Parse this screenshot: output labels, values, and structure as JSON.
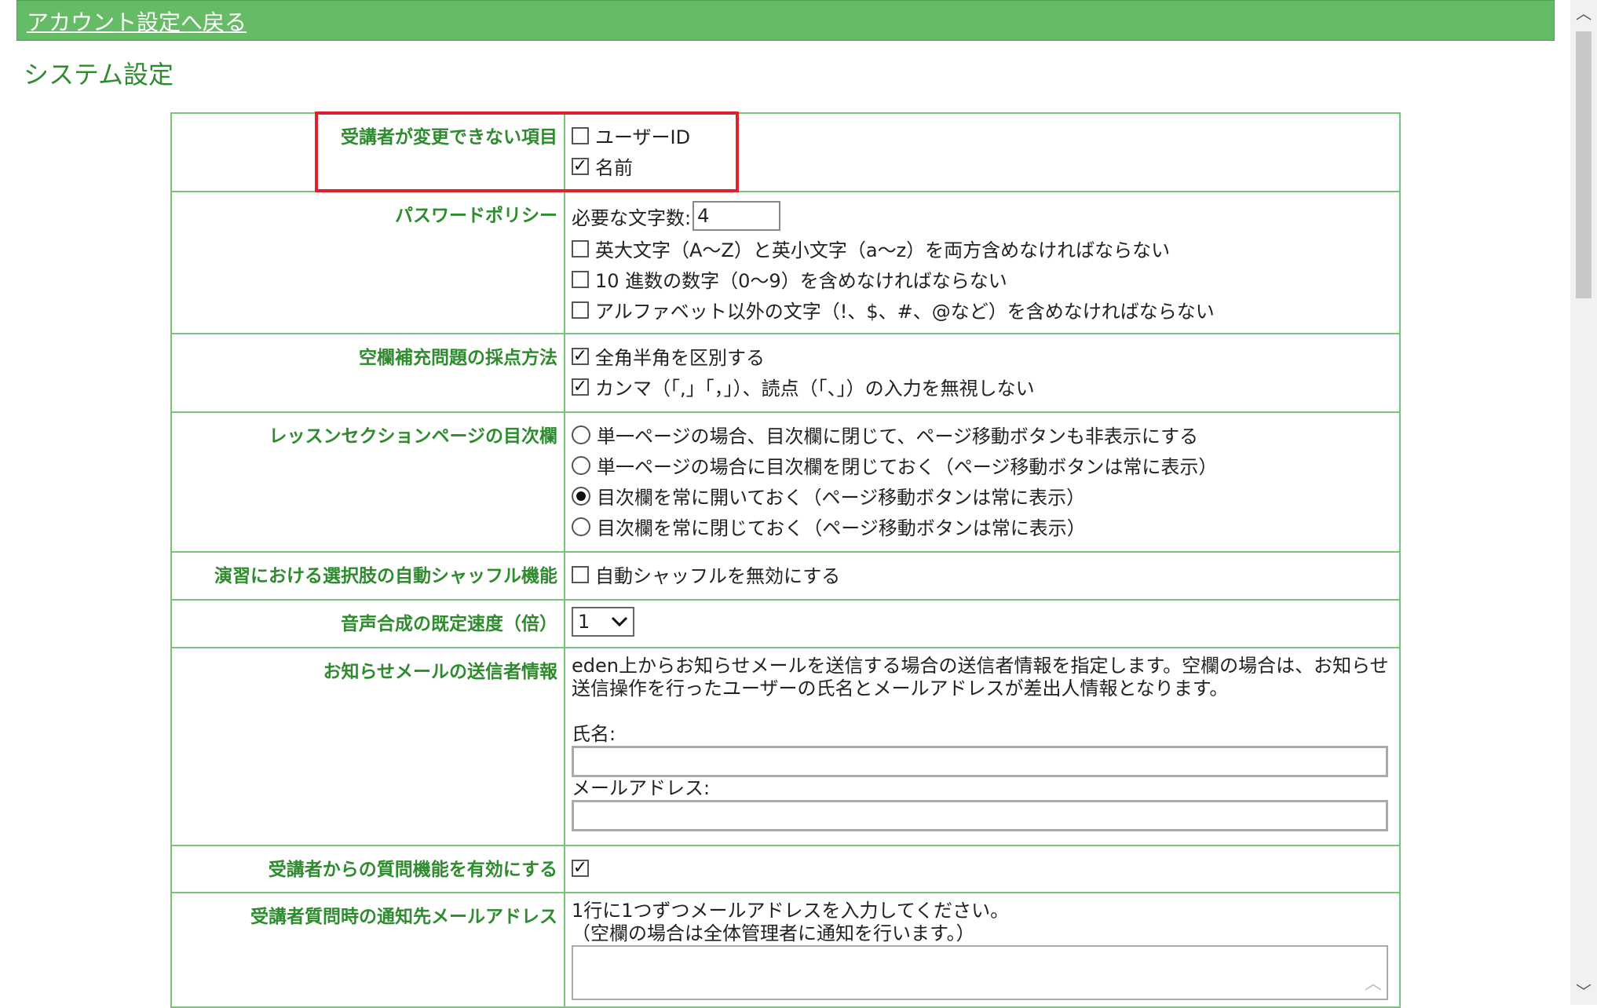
{
  "topbar": {
    "back_link": "アカウント設定へ戻る"
  },
  "page_title": "システム設定",
  "colors": {
    "bar": "#66bb66",
    "label_text": "#2e8b2e",
    "border": "#78c478",
    "highlight": "#e0202a"
  },
  "rows": {
    "readonly_items": {
      "label": "受講者が変更できない項目",
      "options": [
        {
          "label": "ユーザーID",
          "checked": false
        },
        {
          "label": "名前",
          "checked": true
        }
      ]
    },
    "password_policy": {
      "label": "パスワードポリシー",
      "min_chars_label": "必要な文字数:",
      "min_chars_value": "4",
      "options": [
        {
          "label": "英大文字（A～Z）と英小文字（a～z）を両方含めなければならない",
          "checked": false
        },
        {
          "label": "10 進数の数字（0～9）を含めなければならない",
          "checked": false
        },
        {
          "label": "アルファベット以外の文字（!、$、#、@など）を含めなければならない",
          "checked": false
        }
      ]
    },
    "blank_scoring": {
      "label": "空欄補充問題の採点方法",
      "options": [
        {
          "label": "全角半角を区別する",
          "checked": true
        },
        {
          "label": "カンマ（「,」「，」）、読点（「、」）の入力を無視しない",
          "checked": true
        }
      ]
    },
    "toc": {
      "label": "レッスンセクションページの目次欄",
      "options": [
        {
          "label": "単一ページの場合、目次欄に閉じて、ページ移動ボタンも非表示にする",
          "selected": false
        },
        {
          "label": "単一ページの場合に目次欄を閉じておく（ページ移動ボタンは常に表示）",
          "selected": false
        },
        {
          "label": "目次欄を常に開いておく（ページ移動ボタンは常に表示）",
          "selected": true
        },
        {
          "label": "目次欄を常に閉じておく（ページ移動ボタンは常に表示）",
          "selected": false
        }
      ]
    },
    "shuffle": {
      "label": "演習における選択肢の自動シャッフル機能",
      "option": {
        "label": "自動シャッフルを無効にする",
        "checked": false
      }
    },
    "tts_speed": {
      "label": "音声合成の既定速度（倍）",
      "selected": "1"
    },
    "notice_sender": {
      "label": "お知らせメールの送信者情報",
      "description1": "eden上からお知らせメールを送信する場合の送信者情報を指定します。空欄の場合は、お知らせ",
      "description2": "送信操作を行ったユーザーの氏名とメールアドレスが差出人情報となります。",
      "name_label": "氏名:",
      "name_value": "",
      "email_label": "メールアドレス:",
      "email_value": ""
    },
    "question_enable": {
      "label": "受講者からの質問機能を有効にする",
      "checked": true
    },
    "question_notify": {
      "label": "受講者質問時の通知先メールアドレス",
      "description1": "1行に1つずつメールアドレスを入力してください。",
      "description2": "（空欄の場合は全体管理者に通知を行います。）",
      "value": ""
    }
  },
  "icons": {
    "check": "check-icon",
    "dropdown": "chevron-down-icon",
    "scroll_up": "chevron-up-icon",
    "scroll_down": "chevron-down-icon"
  }
}
